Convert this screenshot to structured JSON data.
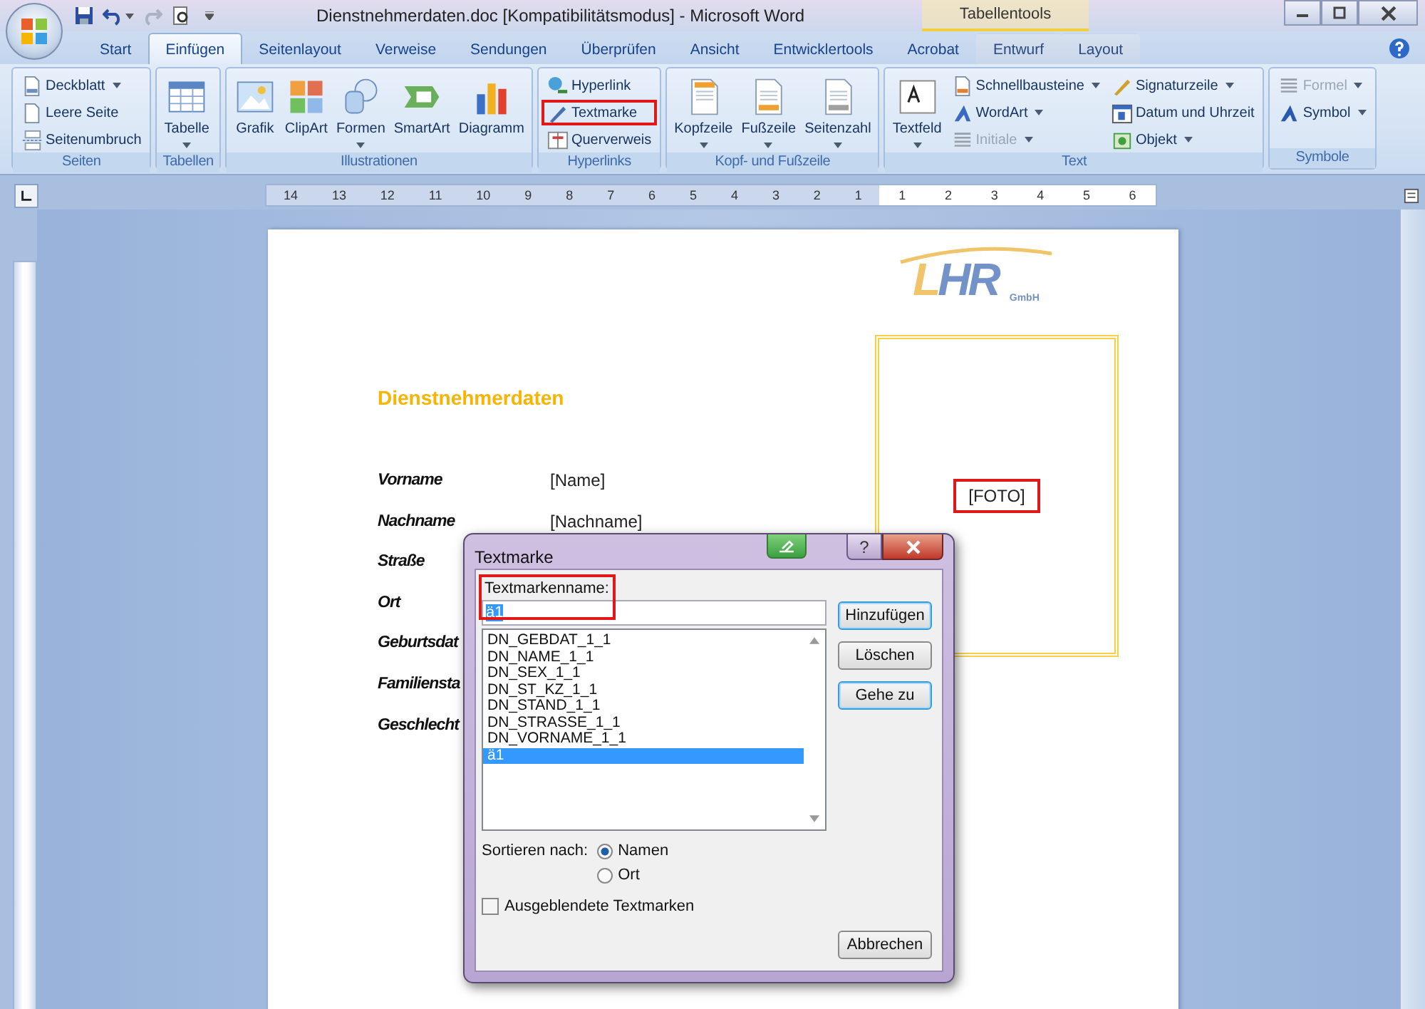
{
  "window": {
    "title": "Dienstnehmerdaten.doc [Kompatibilitätsmodus] - Microsoft Word",
    "context_label": "Tabellentools"
  },
  "tabs": [
    {
      "label": "Start",
      "selected": false,
      "contextual": false
    },
    {
      "label": "Einfügen",
      "selected": true,
      "contextual": false
    },
    {
      "label": "Seitenlayout",
      "selected": false,
      "contextual": false
    },
    {
      "label": "Verweise",
      "selected": false,
      "contextual": false
    },
    {
      "label": "Sendungen",
      "selected": false,
      "contextual": false
    },
    {
      "label": "Überprüfen",
      "selected": false,
      "contextual": false
    },
    {
      "label": "Ansicht",
      "selected": false,
      "contextual": false
    },
    {
      "label": "Entwicklertools",
      "selected": false,
      "contextual": false
    },
    {
      "label": "Acrobat",
      "selected": false,
      "contextual": false
    },
    {
      "label": "Entwurf",
      "selected": false,
      "contextual": true
    },
    {
      "label": "Layout",
      "selected": false,
      "contextual": true
    }
  ],
  "ribbon_groups": [
    {
      "label": "Seiten",
      "items": [
        {
          "kind": "small",
          "label": "Deckblatt",
          "dropdown": true,
          "disabled": false,
          "annotated": false
        },
        {
          "kind": "small",
          "label": "Leere Seite",
          "dropdown": false,
          "disabled": false,
          "annotated": false
        },
        {
          "kind": "small",
          "label": "Seitenumbruch",
          "dropdown": false,
          "disabled": false,
          "annotated": false
        }
      ]
    },
    {
      "label": "Tabellen",
      "items": [
        {
          "kind": "large",
          "label": "Tabelle",
          "dropdown": true,
          "disabled": false,
          "annotated": false
        }
      ]
    },
    {
      "label": "Illustrationen",
      "items": [
        {
          "kind": "large",
          "label": "Grafik",
          "dropdown": false,
          "disabled": false,
          "annotated": false
        },
        {
          "kind": "large",
          "label": "ClipArt",
          "dropdown": false,
          "disabled": false,
          "annotated": false
        },
        {
          "kind": "large",
          "label": "Formen",
          "dropdown": true,
          "disabled": false,
          "annotated": false
        },
        {
          "kind": "large",
          "label": "SmartArt",
          "dropdown": false,
          "disabled": false,
          "annotated": false
        },
        {
          "kind": "large",
          "label": "Diagramm",
          "dropdown": false,
          "disabled": false,
          "annotated": false
        }
      ]
    },
    {
      "label": "Hyperlinks",
      "items": [
        {
          "kind": "small",
          "label": "Hyperlink",
          "dropdown": false,
          "disabled": false,
          "annotated": false
        },
        {
          "kind": "small",
          "label": "Textmarke",
          "dropdown": false,
          "disabled": false,
          "annotated": true
        },
        {
          "kind": "small",
          "label": "Querverweis",
          "dropdown": false,
          "disabled": false,
          "annotated": false
        }
      ]
    },
    {
      "label": "Kopf- und Fußzeile",
      "items": [
        {
          "kind": "large",
          "label": "Kopfzeile",
          "dropdown": true,
          "disabled": false,
          "annotated": false
        },
        {
          "kind": "large",
          "label": "Fußzeile",
          "dropdown": true,
          "disabled": false,
          "annotated": false
        },
        {
          "kind": "large",
          "label": "Seitenzahl",
          "dropdown": true,
          "disabled": false,
          "annotated": false
        }
      ]
    },
    {
      "label": "Text",
      "items": [
        {
          "kind": "large",
          "label": "Textfeld",
          "dropdown": true,
          "disabled": false,
          "annotated": false
        },
        {
          "kind": "small",
          "label": "Schnellbausteine",
          "dropdown": true,
          "disabled": false,
          "annotated": false
        },
        {
          "kind": "small",
          "label": "WordArt",
          "dropdown": true,
          "disabled": false,
          "annotated": false
        },
        {
          "kind": "small",
          "label": "Initiale",
          "dropdown": true,
          "disabled": true,
          "annotated": false
        },
        {
          "kind": "small",
          "label": "Signaturzeile",
          "dropdown": true,
          "disabled": false,
          "annotated": false
        },
        {
          "kind": "small",
          "label": "Datum und Uhrzeit",
          "dropdown": false,
          "disabled": false,
          "annotated": false
        },
        {
          "kind": "small",
          "label": "Objekt",
          "dropdown": true,
          "disabled": false,
          "annotated": false
        }
      ]
    },
    {
      "label": "Symbole",
      "items": [
        {
          "kind": "small",
          "label": "Formel",
          "dropdown": true,
          "disabled": true,
          "annotated": false
        },
        {
          "kind": "small",
          "label": "Symbol",
          "dropdown": true,
          "disabled": false,
          "annotated": false
        }
      ]
    }
  ],
  "ruler": {
    "left_numbers": [
      "14",
      "13",
      "12",
      "11",
      "10",
      "9",
      "8",
      "7",
      "6",
      "5",
      "4",
      "3",
      "2",
      "1"
    ],
    "right_numbers": [
      "1",
      "2",
      "3",
      "4",
      "5",
      "6"
    ]
  },
  "document": {
    "logo": {
      "letters": [
        {
          "text": "L",
          "color": "#f2c46a"
        },
        {
          "text": "H",
          "color": "#7393c8"
        },
        {
          "text": "R",
          "color": "#7393c8"
        }
      ],
      "subtext": "GmbH"
    },
    "heading": "Dienstnehmerdaten",
    "fields": [
      {
        "label": "Vorname",
        "value": "[Name]"
      },
      {
        "label": "Nachname",
        "value": "[Nachname]"
      },
      {
        "label": "Straße"
      },
      {
        "label": "Ort"
      },
      {
        "label": "Geburtsdat"
      },
      {
        "label": "Familiensta"
      },
      {
        "label": "Geschlecht"
      }
    ],
    "photo": {
      "text": "[FOTO]",
      "annotated": true
    }
  },
  "dialog": {
    "title": "Textmarke",
    "help": "?",
    "name_label": "Textmarkenname:",
    "name_annotated": true,
    "name_value": "ä1",
    "bookmarks": [
      {
        "label": "DN_GEBDAT_1_1",
        "selected": false
      },
      {
        "label": "DN_NAME_1_1",
        "selected": false
      },
      {
        "label": "DN_SEX_1_1",
        "selected": false
      },
      {
        "label": "DN_ST_KZ_1_1",
        "selected": false
      },
      {
        "label": "DN_STAND_1_1",
        "selected": false
      },
      {
        "label": "DN_STRASSE_1_1",
        "selected": false
      },
      {
        "label": "DN_VORNAME_1_1",
        "selected": false
      },
      {
        "label": "ä1",
        "selected": true
      }
    ],
    "side_buttons": [
      {
        "label": "Hinzufügen",
        "focused": true
      },
      {
        "label": "Löschen",
        "focused": false
      },
      {
        "label": "Gehe zu",
        "focused": true
      }
    ],
    "sort_label": "Sortieren nach:",
    "sort_options": [
      {
        "label": "Namen",
        "selected": true
      },
      {
        "label": "Ort",
        "selected": false
      }
    ],
    "hidden_checkbox": {
      "label": "Ausgeblendete Textmarken",
      "checked": false
    },
    "cancel": "Abbrechen"
  }
}
